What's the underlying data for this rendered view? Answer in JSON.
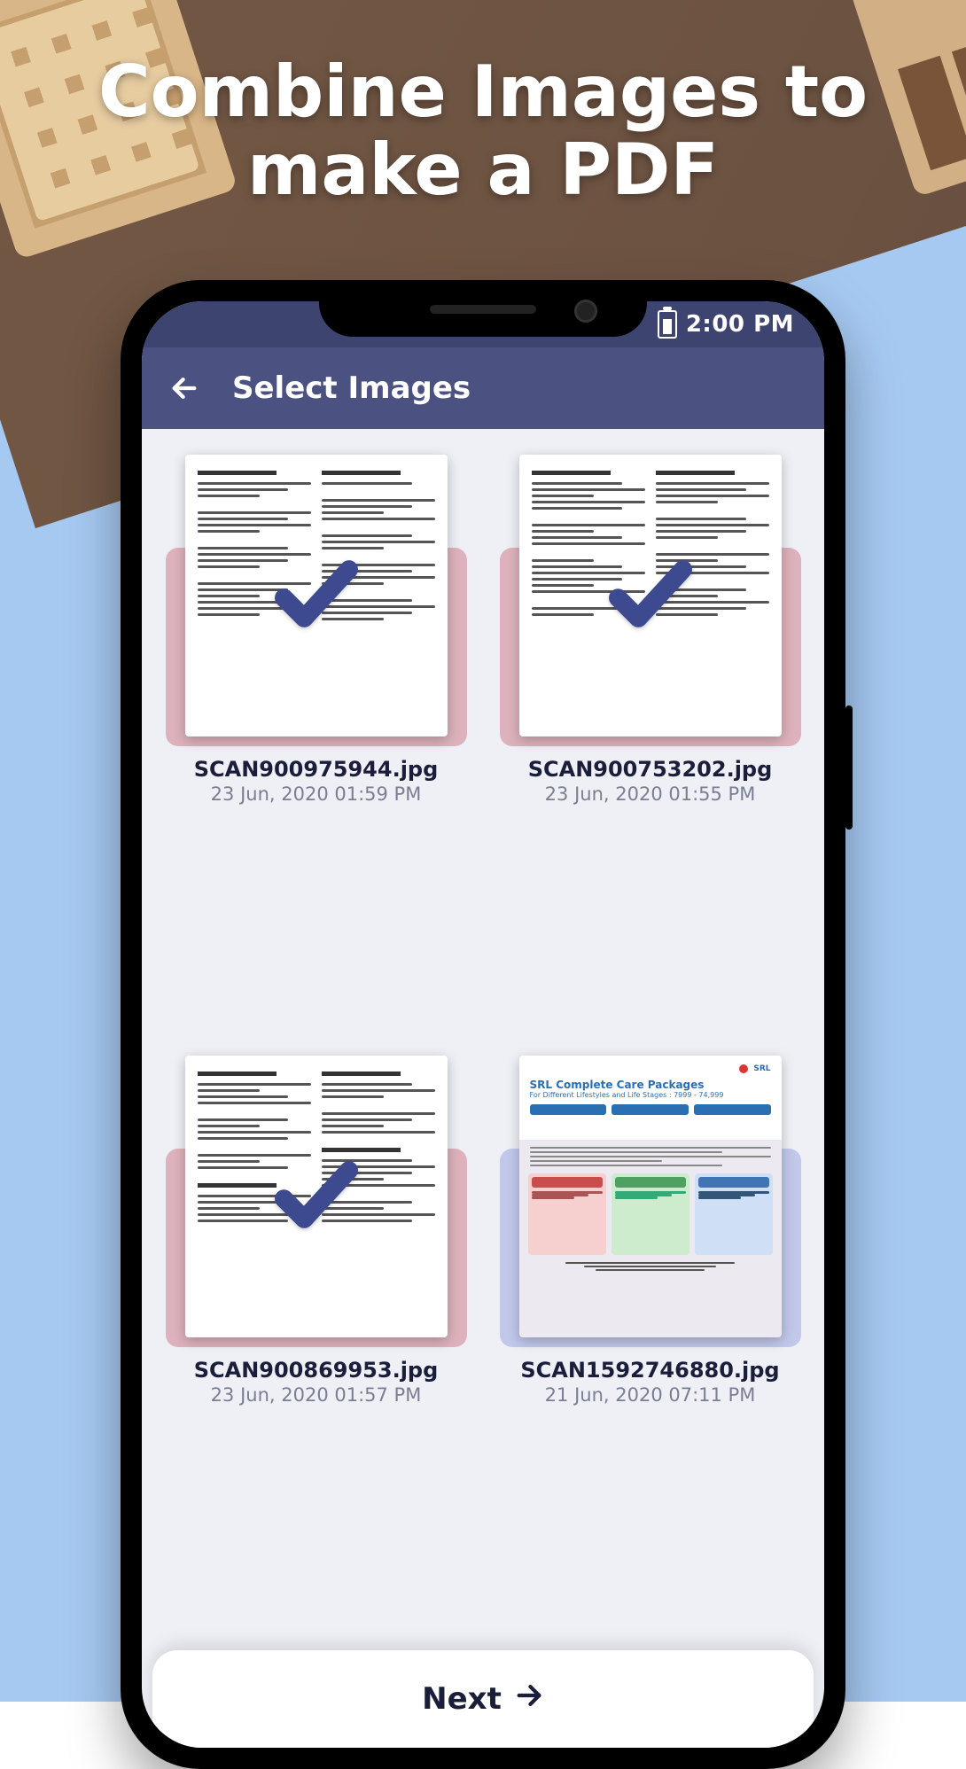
{
  "hero": {
    "line1": "Combine Images to",
    "line2": "make a PDF"
  },
  "statusbar": {
    "time": "2:00 PM"
  },
  "appbar": {
    "title": "Select Images"
  },
  "images": [
    {
      "filename": "SCAN900975944.jpg",
      "date": "23 Jun, 2020 01:59 PM",
      "selected": true,
      "kind": "doc"
    },
    {
      "filename": "SCAN900753202.jpg",
      "date": "23 Jun, 2020 01:55 PM",
      "selected": true,
      "kind": "doc"
    },
    {
      "filename": "SCAN900869953.jpg",
      "date": "23 Jun, 2020 01:57 PM",
      "selected": true,
      "kind": "doc"
    },
    {
      "filename": "SCAN1592746880.jpg",
      "date": "21 Jun, 2020 07:11 PM",
      "selected": false,
      "kind": "brochure",
      "brochure": {
        "brand": "SRL",
        "title": "SRL Complete Care Packages",
        "subtitle": "For Different Lifestyles and Life Stages : 7999 - 74,999"
      }
    }
  ],
  "next": {
    "label": "Next"
  }
}
